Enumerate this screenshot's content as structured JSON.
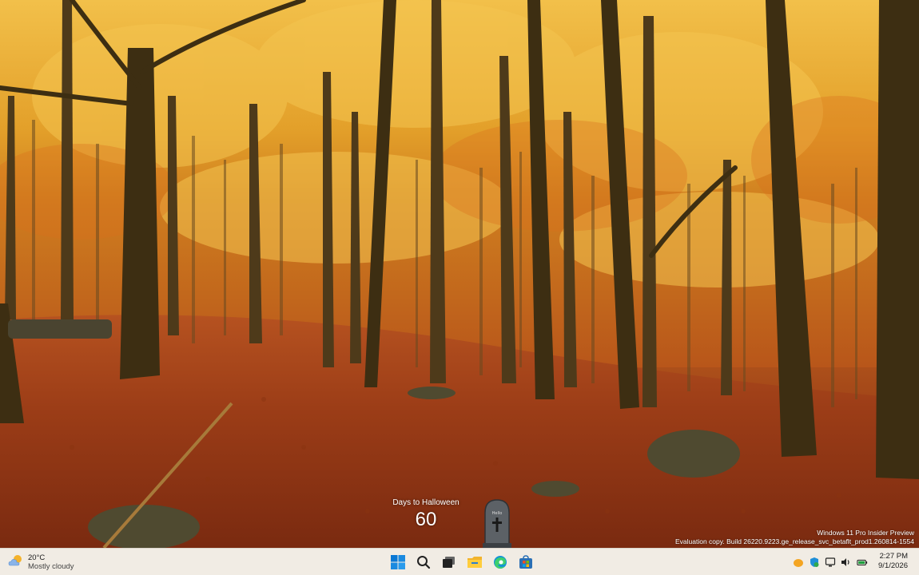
{
  "desktop": {
    "watermark_line1": "Windows 11 Pro Insider Preview",
    "watermark_line2": "Evaluation copy. Build 26220.9223.ge_release_svc_betaflt_prod1.260814-1554"
  },
  "halloween_widget": {
    "label": "Days to Halloween",
    "days": "60",
    "tombstone_text": "Hello"
  },
  "taskbar": {
    "weather": {
      "temperature": "20°C",
      "condition": "Mostly cloudy",
      "icon": "partly-cloudy-icon"
    },
    "center_icons": [
      "start-icon",
      "search-icon",
      "task-view-icon",
      "file-explorer-icon",
      "edge-icon",
      "microsoft-store-icon"
    ],
    "tray_icons": [
      "tray-app-icon",
      "defender-icon",
      "network-icon",
      "volume-icon",
      "battery-icon"
    ],
    "clock": {
      "time": "2:27 PM",
      "date": "9/1/2026"
    }
  },
  "colors": {
    "taskbar_bg": "#f1ece4",
    "accent_blue": "#0078d4"
  }
}
